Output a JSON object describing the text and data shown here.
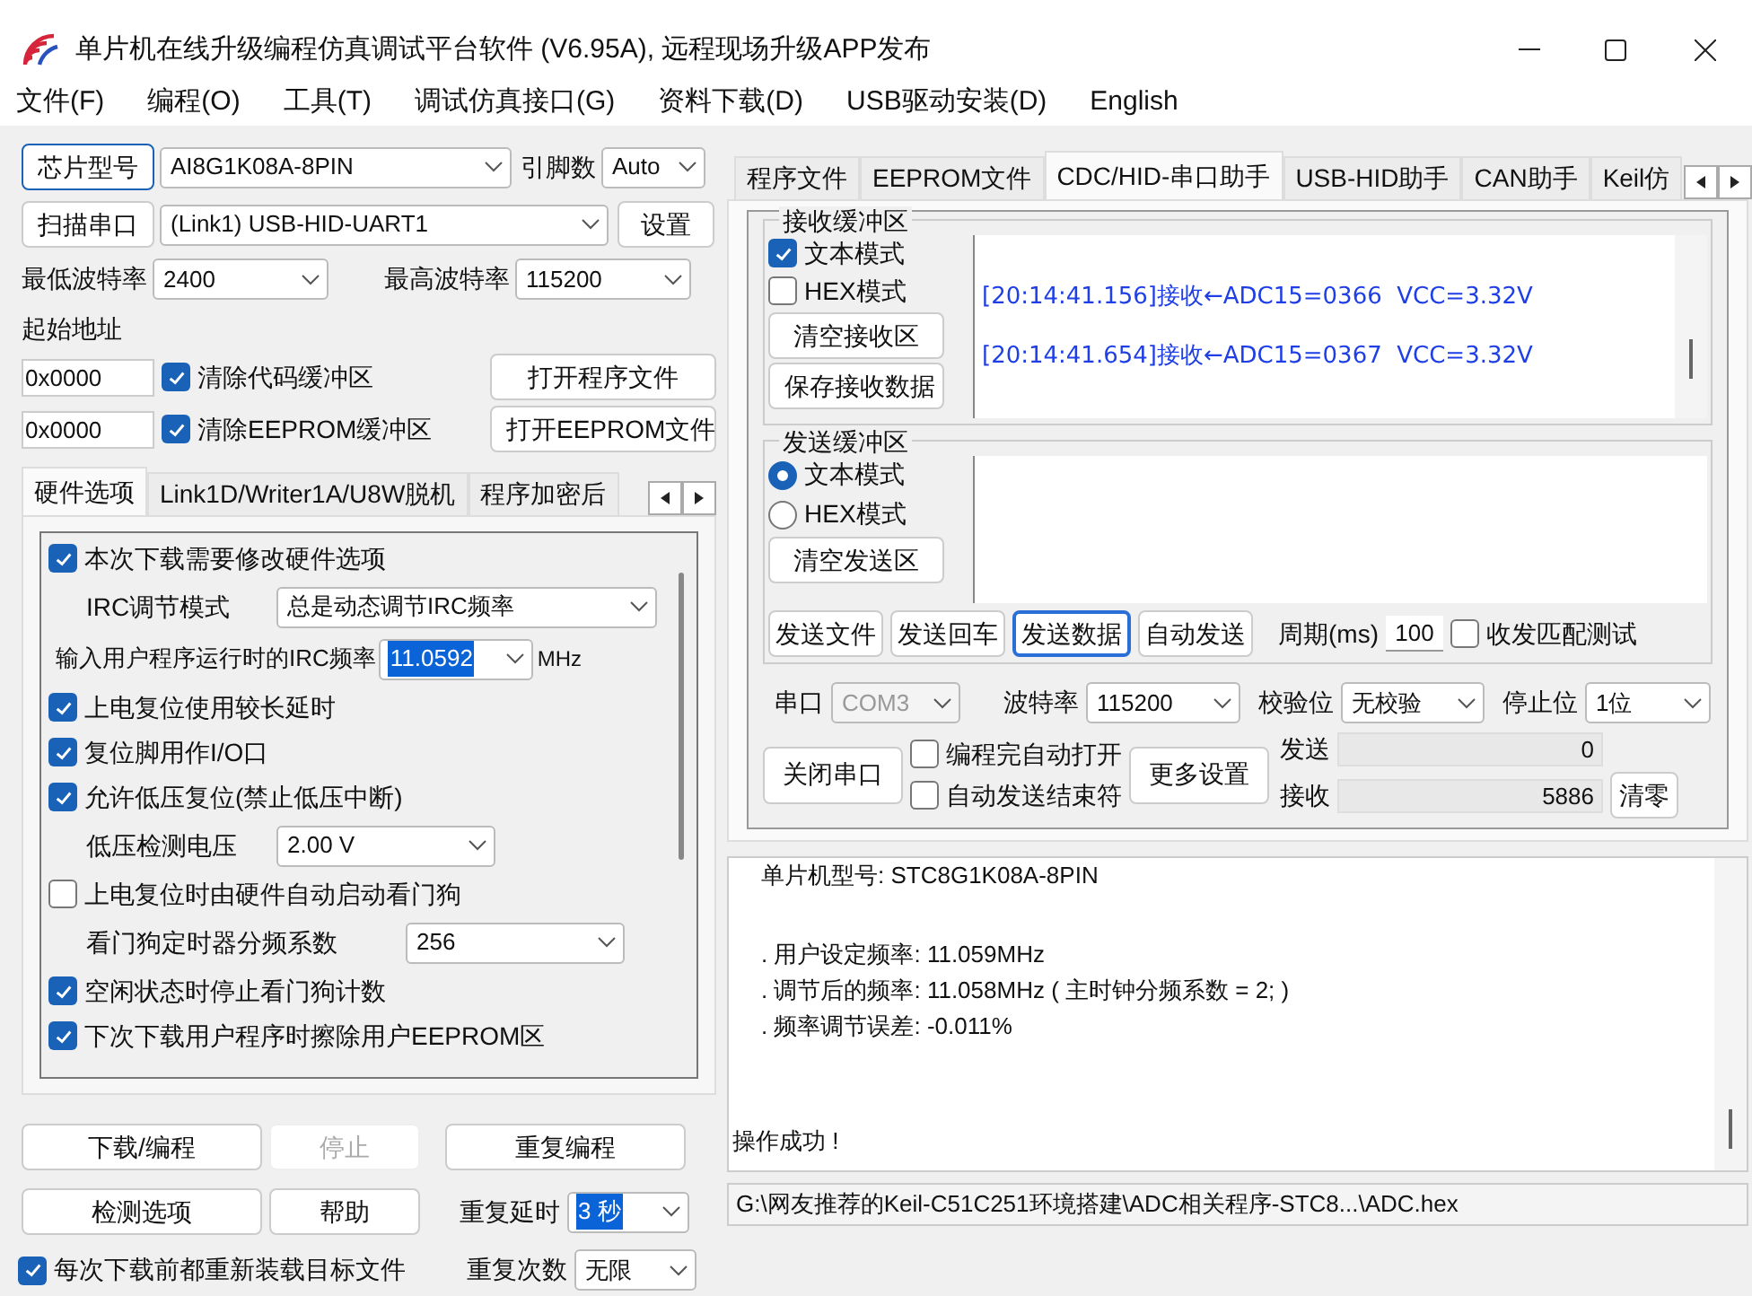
{
  "window": {
    "title": "单片机在线升级编程仿真调试平台软件 (V6.95A), 远程现场升级APP发布"
  },
  "menu": [
    "文件(F)",
    "编程(O)",
    "工具(T)",
    "调试仿真接口(G)",
    "资料下载(D)",
    "USB驱动安装(D)",
    "English"
  ],
  "chip": {
    "button": "芯片型号",
    "value": "AI8G1K08A-8PIN",
    "pins_label": "引脚数",
    "pins_value": "Auto"
  },
  "port": {
    "button": "扫描串口",
    "value": "(Link1) USB-HID-UART1",
    "settings_button": "设置"
  },
  "baud": {
    "min_label": "最低波特率",
    "min_value": "2400",
    "max_label": "最高波特率",
    "max_value": "115200"
  },
  "start_address": {
    "label": "起始地址",
    "rows": [
      {
        "address": "0x0000",
        "checkbox": "清除代码缓冲区",
        "checked": true,
        "button": "打开程序文件"
      },
      {
        "address": "0x0000",
        "checkbox": "清除EEPROM缓冲区",
        "checked": true,
        "button": "打开EEPROM文件"
      }
    ]
  },
  "left_tabs": [
    {
      "label": "硬件选项",
      "selected": true
    },
    {
      "label": "Link1D/Writer1A/U8W脱机",
      "selected": false
    },
    {
      "label": "程序加密后",
      "selected": false
    }
  ],
  "hardware_options": [
    {
      "kind": "checkbox",
      "label": "本次下载需要修改硬件选项",
      "checked": true
    },
    {
      "kind": "select",
      "label": "IRC调节模式",
      "value": "总是动态调节IRC频率"
    },
    {
      "kind": "frequency",
      "label": "输入用户程序运行时的IRC频率",
      "value": "11.0592",
      "unit": "MHz",
      "highlighted": true
    },
    {
      "kind": "checkbox",
      "label": "上电复位使用较长延时",
      "checked": true
    },
    {
      "kind": "checkbox",
      "label": "复位脚用作I/O口",
      "checked": true
    },
    {
      "kind": "checkbox",
      "label": "允许低压复位(禁止低压中断)",
      "checked": true
    },
    {
      "kind": "select",
      "label": "低压检测电压",
      "value": "2.00 V"
    },
    {
      "kind": "checkbox",
      "label": "上电复位时由硬件自动启动看门狗",
      "checked": false
    },
    {
      "kind": "select",
      "label": "看门狗定时器分频系数",
      "value": "256"
    },
    {
      "kind": "checkbox",
      "label": "空闲状态时停止看门狗计数",
      "checked": true
    },
    {
      "kind": "checkbox",
      "label": "下次下载用户程序时擦除用户EEPROM区",
      "checked": true
    }
  ],
  "actions": {
    "download": "下载/编程",
    "stop": {
      "label": "停止",
      "disabled": true
    },
    "repeat": "重复编程",
    "check": "检测选项",
    "help": "帮助",
    "delay_label": "重复延时",
    "delay_value": "3 秒",
    "delay_highlighted": true,
    "reload": {
      "label": "每次下载前都重新装载目标文件",
      "checked": true
    },
    "count_label": "重复次数",
    "count_value": "无限"
  },
  "right_tabs": [
    {
      "label": "程序文件",
      "selected": false
    },
    {
      "label": "EEPROM文件",
      "selected": false
    },
    {
      "label": "CDC/HID-串口助手",
      "selected": true
    },
    {
      "label": "USB-HID助手",
      "selected": false
    },
    {
      "label": "CAN助手",
      "selected": false
    },
    {
      "label": "Keil仿",
      "selected": false
    }
  ],
  "receive": {
    "title": "接收缓冲区",
    "modes": [
      {
        "label": "文本模式",
        "checked": true
      },
      {
        "label": "HEX模式",
        "checked": false
      }
    ],
    "buttons": [
      "清空接收区",
      "保存接收数据"
    ],
    "lines": [
      "[20:14:41.156]接收←ADC15=0366  VCC=3.32V",
      "[20:14:41.654]接收←ADC15=0367  VCC=3.32V"
    ]
  },
  "send": {
    "title": "发送缓冲区",
    "modes": [
      {
        "label": "文本模式",
        "selected": true
      },
      {
        "label": "HEX模式",
        "selected": false
      }
    ],
    "clear_button": "清空发送区",
    "buttons": [
      {
        "label": "发送文件",
        "focused": false
      },
      {
        "label": "发送回车",
        "focused": false
      },
      {
        "label": "发送数据",
        "focused": true
      },
      {
        "label": "自动发送",
        "focused": false
      }
    ],
    "period_label": "周期(ms)",
    "period_value": "100",
    "match_test": {
      "label": "收发匹配测试",
      "checked": false
    }
  },
  "serial": {
    "port_label": "串口",
    "port_value": "COM3",
    "port_disabled": true,
    "baud_label": "波特率",
    "baud_value": "115200",
    "parity_label": "校验位",
    "parity_value": "无校验",
    "stop_label": "停止位",
    "stop_value": "1位",
    "close_button": "关闭串口",
    "options": [
      {
        "label": "编程完自动打开",
        "checked": false
      },
      {
        "label": "自动发送结束符",
        "checked": false
      }
    ],
    "more_button": "更多设置",
    "counters": [
      {
        "label": "发送",
        "value": "0"
      },
      {
        "label": "接收",
        "value": "5886"
      }
    ],
    "clear_button": "清零"
  },
  "log": [
    [
      "单片机型号: STC8G1K08A-8PIN"
    ],
    [
      ". 用户设定频率: 11.059MHz",
      ". 调节后的频率: 11.058MHz ( 主时钟分频系数 = 2; )",
      ". 频率调节误差: -0.011%"
    ],
    [
      "操作成功 !"
    ]
  ],
  "file_path": "G:\\网友推荐的Keil-C51C251环境搭建\\ADC相关程序-STC8...\\ADC.hex"
}
